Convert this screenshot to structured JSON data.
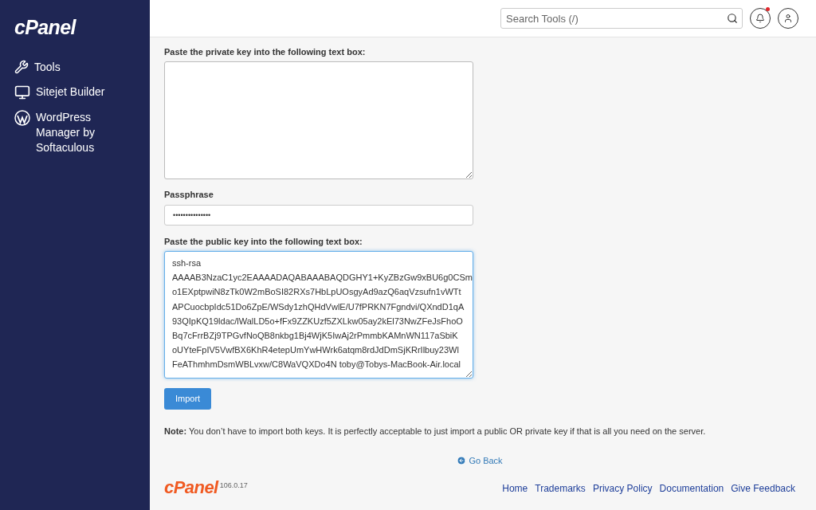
{
  "sidebar": {
    "logo": "cPanel",
    "items": [
      {
        "kind": "tools",
        "label": "Tools"
      },
      {
        "kind": "sitejet",
        "label": "Sitejet Builder"
      },
      {
        "kind": "wordpress",
        "label": "WordPress Manager by Softaculous"
      }
    ]
  },
  "header": {
    "search": {
      "placeholder": "Search Tools (/)"
    },
    "notifications": {
      "unread": true
    }
  },
  "form": {
    "private_key": {
      "label": "Paste the private key into the following text box:"
    },
    "passphrase": {
      "label": "Passphrase",
      "value": "•••••••••••••••"
    },
    "public_key": {
      "label": "Paste the public key into the following text box:",
      "focused": true,
      "lines": [
        "ssh-rsa",
        "AAAAB3NzaC1yc2EAAAADAQABAAABAQDGHY1+KyZBzGw9xBU6g0CSm",
        "o1EXptpwiN8zTk0W2mBoSI82RXs7HbLpUOsgyAd9azQ6aqVzsufn1vWTt",
        "APCuocbpIdc51Do6ZpE/WSdy1zhQHdVwlE/U7fPRKN7Fgndvi/QXndD1qA",
        "93QIpKQ19ldac/lWalLD5o+fFx9ZZKUzf5ZXLkw05ay2kEl73NwZFeJsFhoO",
        "Bq7cFrrBZj9TPGvfNoQB8nkbg1Bj4WjK5IwAj2rPmmbKAMnWN117aSbiK",
        "oUYteFpIV5VwfBX6KhR4etepUmYwHWrk6atqm8rdJdDmSjKRrIlbuy23Wl",
        "FeAThmhmDsmWBLvxw/C8WaVQXDo4N toby@Tobys-MacBook-Air.local"
      ]
    },
    "import_button": "Import",
    "note": "**Note:** You don’t have to import both keys. It is perfectly acceptable to just import a public OR private key if that is all you need on the server.",
    "go_back": "Go Back"
  },
  "footer": {
    "logo": "cPanel",
    "version": "106.0.17",
    "links": [
      "Home",
      "Trademarks",
      "Privacy Policy",
      "Documentation",
      "Give Feedback"
    ]
  }
}
